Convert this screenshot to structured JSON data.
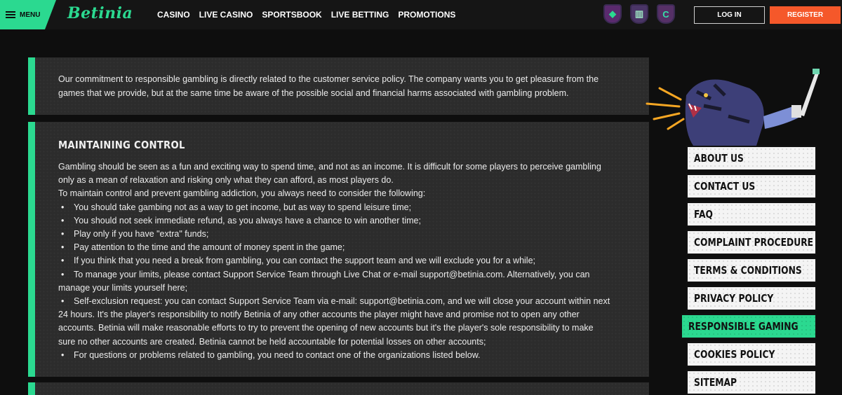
{
  "header": {
    "menu_label": "MENU",
    "logo_text": "Betinia",
    "nav": [
      "CASINO",
      "LIVE CASINO",
      "SPORTSBOOK",
      "LIVE BETTING",
      "PROMOTIONS"
    ],
    "badges": [
      "diamond-badge-icon",
      "stripes-badge-icon",
      "c-badge-icon"
    ],
    "login_label": "LOG IN",
    "register_label": "REGISTER"
  },
  "colors": {
    "accent": "#2bd990",
    "register": "#f5582a",
    "panel": "#2c2c2c"
  },
  "intro": "Our commitment to responsible gambling is directly related to the customer service policy. The company wants you to get pleasure from the games that we provide, but at the same time be aware of the possible social and financial harms associated with gambling problem.",
  "section": {
    "title": "MAINTAINING CONTROL",
    "para1": "Gambling should be seen as a fun and exciting way to spend time, and not as an income. It is difficult for some players to perceive gambling only as a mean of relaxation and risking only what they can afford, as most players do.",
    "para2": "To maintain control and prevent gambling addiction, you always need to consider the following:",
    "bullets": [
      "You should take gambing not as a way to get income, but as way to spend leisure time;",
      "You should not seek immediate refund, as you always have a chance to win another time;",
      "Play only if you have \"extra\" funds;",
      "Pay attention to the time and the amount of money spent in the game;",
      "If you think that you need a break from gambling, you can contact the support team and we will exclude you for a while;",
      "To manage your limits, please contact Support Service Team through Live Chat or e-mail support@betinia.com. Alternatively, you can manage your limits yourself here;",
      "Self-exclusion request: you can contact Support Service Team via e-mail: support@betinia.com, and we will close your account within next 24 hours. It's the player's responsibility to notify Betinia of any other accounts the player might have and promise not to open any other accounts. Betinia will make reasonable efforts to try to prevent the opening of new accounts but it's the player's sole responsibility to make sure no other accounts are created. Betinia cannot be held accountable for potential losses on other accounts;",
      "For questions or problems related to gambling, you need to contact one of the organizations listed below."
    ]
  },
  "side_menu": {
    "items": [
      "ABOUT US",
      "CONTACT US",
      "FAQ",
      "COMPLAINT PROCEDURE",
      "TERMS & CONDITIONS",
      "PRIVACY POLICY",
      "RESPONSIBLE GAMING",
      "COOKIES POLICY",
      "SITEMAP"
    ],
    "active": "RESPONSIBLE GAMING"
  }
}
